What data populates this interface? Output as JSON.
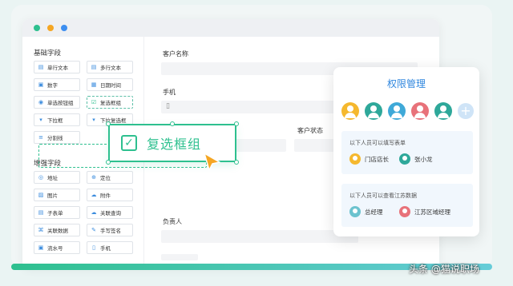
{
  "sidebar": {
    "basic_title": "基础字段",
    "basic_fields": [
      {
        "label": "单行文本",
        "icon": "text-line-icon"
      },
      {
        "label": "多行文本",
        "icon": "text-multi-icon"
      },
      {
        "label": "数字",
        "icon": "number-icon"
      },
      {
        "label": "日期时间",
        "icon": "calendar-icon"
      },
      {
        "label": "单选按钮组",
        "icon": "radio-icon"
      },
      {
        "label": "复选框组",
        "icon": "checkbox-icon"
      },
      {
        "label": "下拉框",
        "icon": "dropdown-icon"
      },
      {
        "label": "下拉复选框",
        "icon": "dropdown-check-icon"
      },
      {
        "label": "分割线",
        "icon": "divider-icon"
      }
    ],
    "enhanced_title": "增强字段",
    "enhanced_fields": [
      {
        "label": "地址",
        "icon": "location-icon"
      },
      {
        "label": "定位",
        "icon": "target-icon"
      },
      {
        "label": "图片",
        "icon": "image-icon"
      },
      {
        "label": "附件",
        "icon": "attachment-icon"
      },
      {
        "label": "子表单",
        "icon": "subform-icon"
      },
      {
        "label": "关联查询",
        "icon": "link-query-icon"
      },
      {
        "label": "关联数据",
        "icon": "link-data-icon"
      },
      {
        "label": "手写签名",
        "icon": "signature-icon"
      },
      {
        "label": "流水号",
        "icon": "serial-icon"
      },
      {
        "label": "手机",
        "icon": "phone-icon"
      }
    ]
  },
  "form": {
    "customer_name_label": "客户名称",
    "phone_label": "手机",
    "customer_status_label": "客户状态",
    "owner_label": "负责人"
  },
  "drag": {
    "label": "复选框组"
  },
  "permissions": {
    "title": "权限管理",
    "avatar_colors": [
      "#f5b82e",
      "#2ea89a",
      "#3fa9d8",
      "#e8727a",
      "#2ea89a"
    ],
    "fill_caption": "以下人员可以填写表单",
    "fill_people": [
      {
        "name": "门店店长",
        "color": "#f5b82e"
      },
      {
        "name": "张小龙",
        "color": "#2ea89a"
      }
    ],
    "view_caption": "以下人员可以查看江苏数据",
    "view_people": [
      {
        "name": "总经理",
        "color": "#6cc3cf"
      },
      {
        "name": "江苏区域经理",
        "color": "#e8727a"
      }
    ]
  },
  "watermark": "头条 @猫说职场",
  "colors": {
    "accent": "#2ec08f",
    "primary": "#2e86de"
  }
}
